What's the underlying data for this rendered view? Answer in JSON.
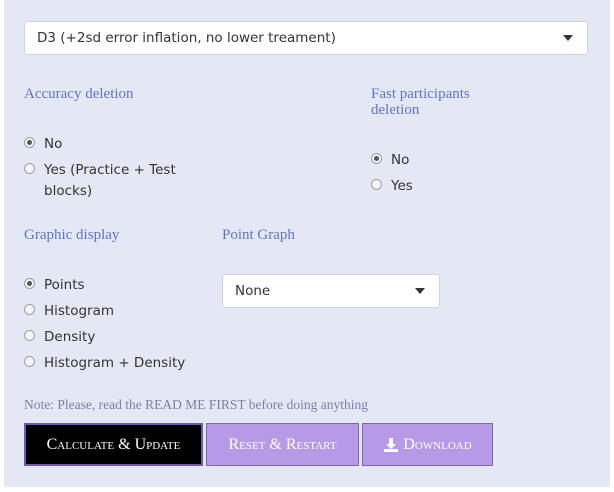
{
  "top_select": {
    "value": "D3 (+2sd error inflation, no lower treament)"
  },
  "accuracy": {
    "heading": "Accuracy deletion",
    "options": [
      {
        "label": "No",
        "selected": true
      },
      {
        "label_line1": "Yes (Practice + Test",
        "label_line2": "blocks)",
        "selected": false
      }
    ]
  },
  "fast": {
    "heading_line1": "Fast participants",
    "heading_line2": "deletion",
    "options": [
      {
        "label": "No",
        "selected": true
      },
      {
        "label": "Yes",
        "selected": false
      }
    ]
  },
  "graphic": {
    "heading": "Graphic display",
    "options": [
      {
        "label": "Points",
        "selected": true
      },
      {
        "label": "Histogram",
        "selected": false
      },
      {
        "label": "Density",
        "selected": false
      },
      {
        "label": "Histogram + Density",
        "selected": false
      }
    ]
  },
  "point_graph": {
    "heading": "Point Graph",
    "value": "None"
  },
  "note": "Note: Please, read the READ ME FIRST before doing anything",
  "buttons": {
    "calculate": "Calculate & Update",
    "reset": "Reset & Restart",
    "download": "Download"
  },
  "icons": {
    "download": "download-icon",
    "dropdown": "chevron-down-icon"
  },
  "colors": {
    "heading": "#6273c8",
    "button_purple": "#b69ae8",
    "button_dark": "#000000",
    "panel_bg": "#e4e8f5"
  }
}
